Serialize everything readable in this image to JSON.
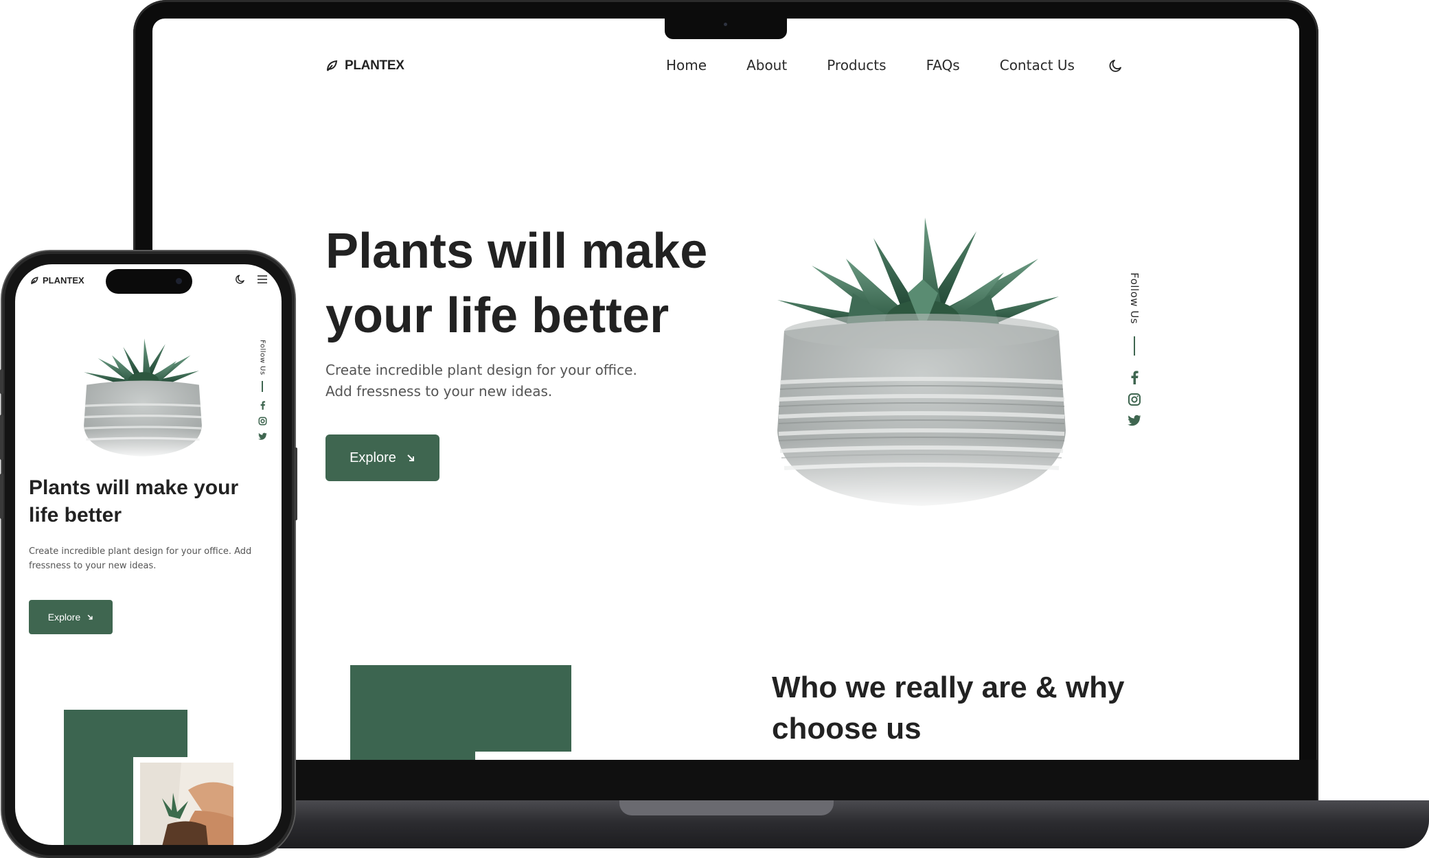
{
  "brand": {
    "name": "PLANTEX",
    "accent": "#3f6650"
  },
  "laptop": {
    "nav": {
      "items": [
        "Home",
        "About",
        "Products",
        "FAQs",
        "Contact Us"
      ],
      "theme_icon": "moon-icon"
    },
    "hero": {
      "title": "Plants will make your life better",
      "description_line1": "Create incredible plant design for your office.",
      "description_line2": "Add fressness to your new ideas.",
      "button_label": "Explore"
    },
    "follow": {
      "label": "Follow Us",
      "icons": [
        "facebook-icon",
        "instagram-icon",
        "twitter-icon"
      ]
    },
    "section": {
      "title": "Who we really are & why choose us"
    }
  },
  "phone": {
    "nav": {
      "icons": [
        "moon-icon",
        "menu-icon"
      ]
    },
    "hero": {
      "title": "Plants will make your life better",
      "description": "Create incredible plant design for your office. Add fressness to your new ideas.",
      "button_label": "Explore"
    },
    "follow": {
      "label": "Follow Us",
      "icons": [
        "facebook-icon",
        "instagram-icon",
        "twitter-icon"
      ]
    }
  }
}
